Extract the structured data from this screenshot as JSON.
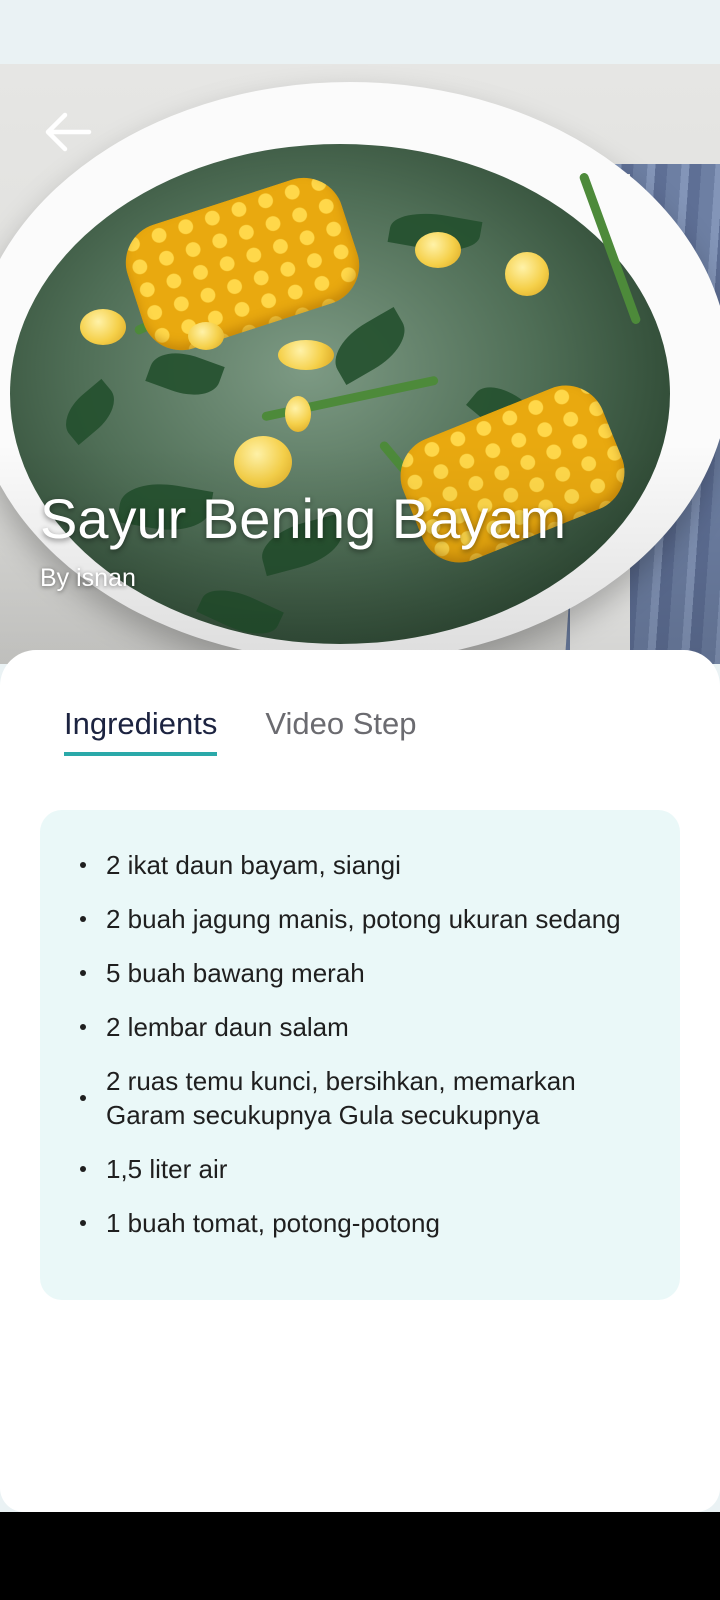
{
  "recipe": {
    "title": "Sayur Bening Bayam",
    "author": "By isnan"
  },
  "tabs": [
    {
      "label": "Ingredients",
      "active": true
    },
    {
      "label": "Video Step",
      "active": false
    }
  ],
  "ingredients": [
    "2 ikat daun bayam, siangi",
    " 2 buah jagung manis, potong ukuran sedang",
    " 5 buah bawang merah",
    " 2 lembar daun salam",
    " 2 ruas temu kunci, bersihkan, memarkan Garam secukupnya Gula secukupnya",
    " 1,5 liter air",
    " 1 buah tomat, potong-potong"
  ],
  "icons": {
    "back": "arrow-left-icon"
  },
  "colors": {
    "accent": "#2aa9a9",
    "card_background": "#eaf8f8",
    "active_tab_text": "#1c2340",
    "inactive_tab_text": "#6b6b70"
  }
}
